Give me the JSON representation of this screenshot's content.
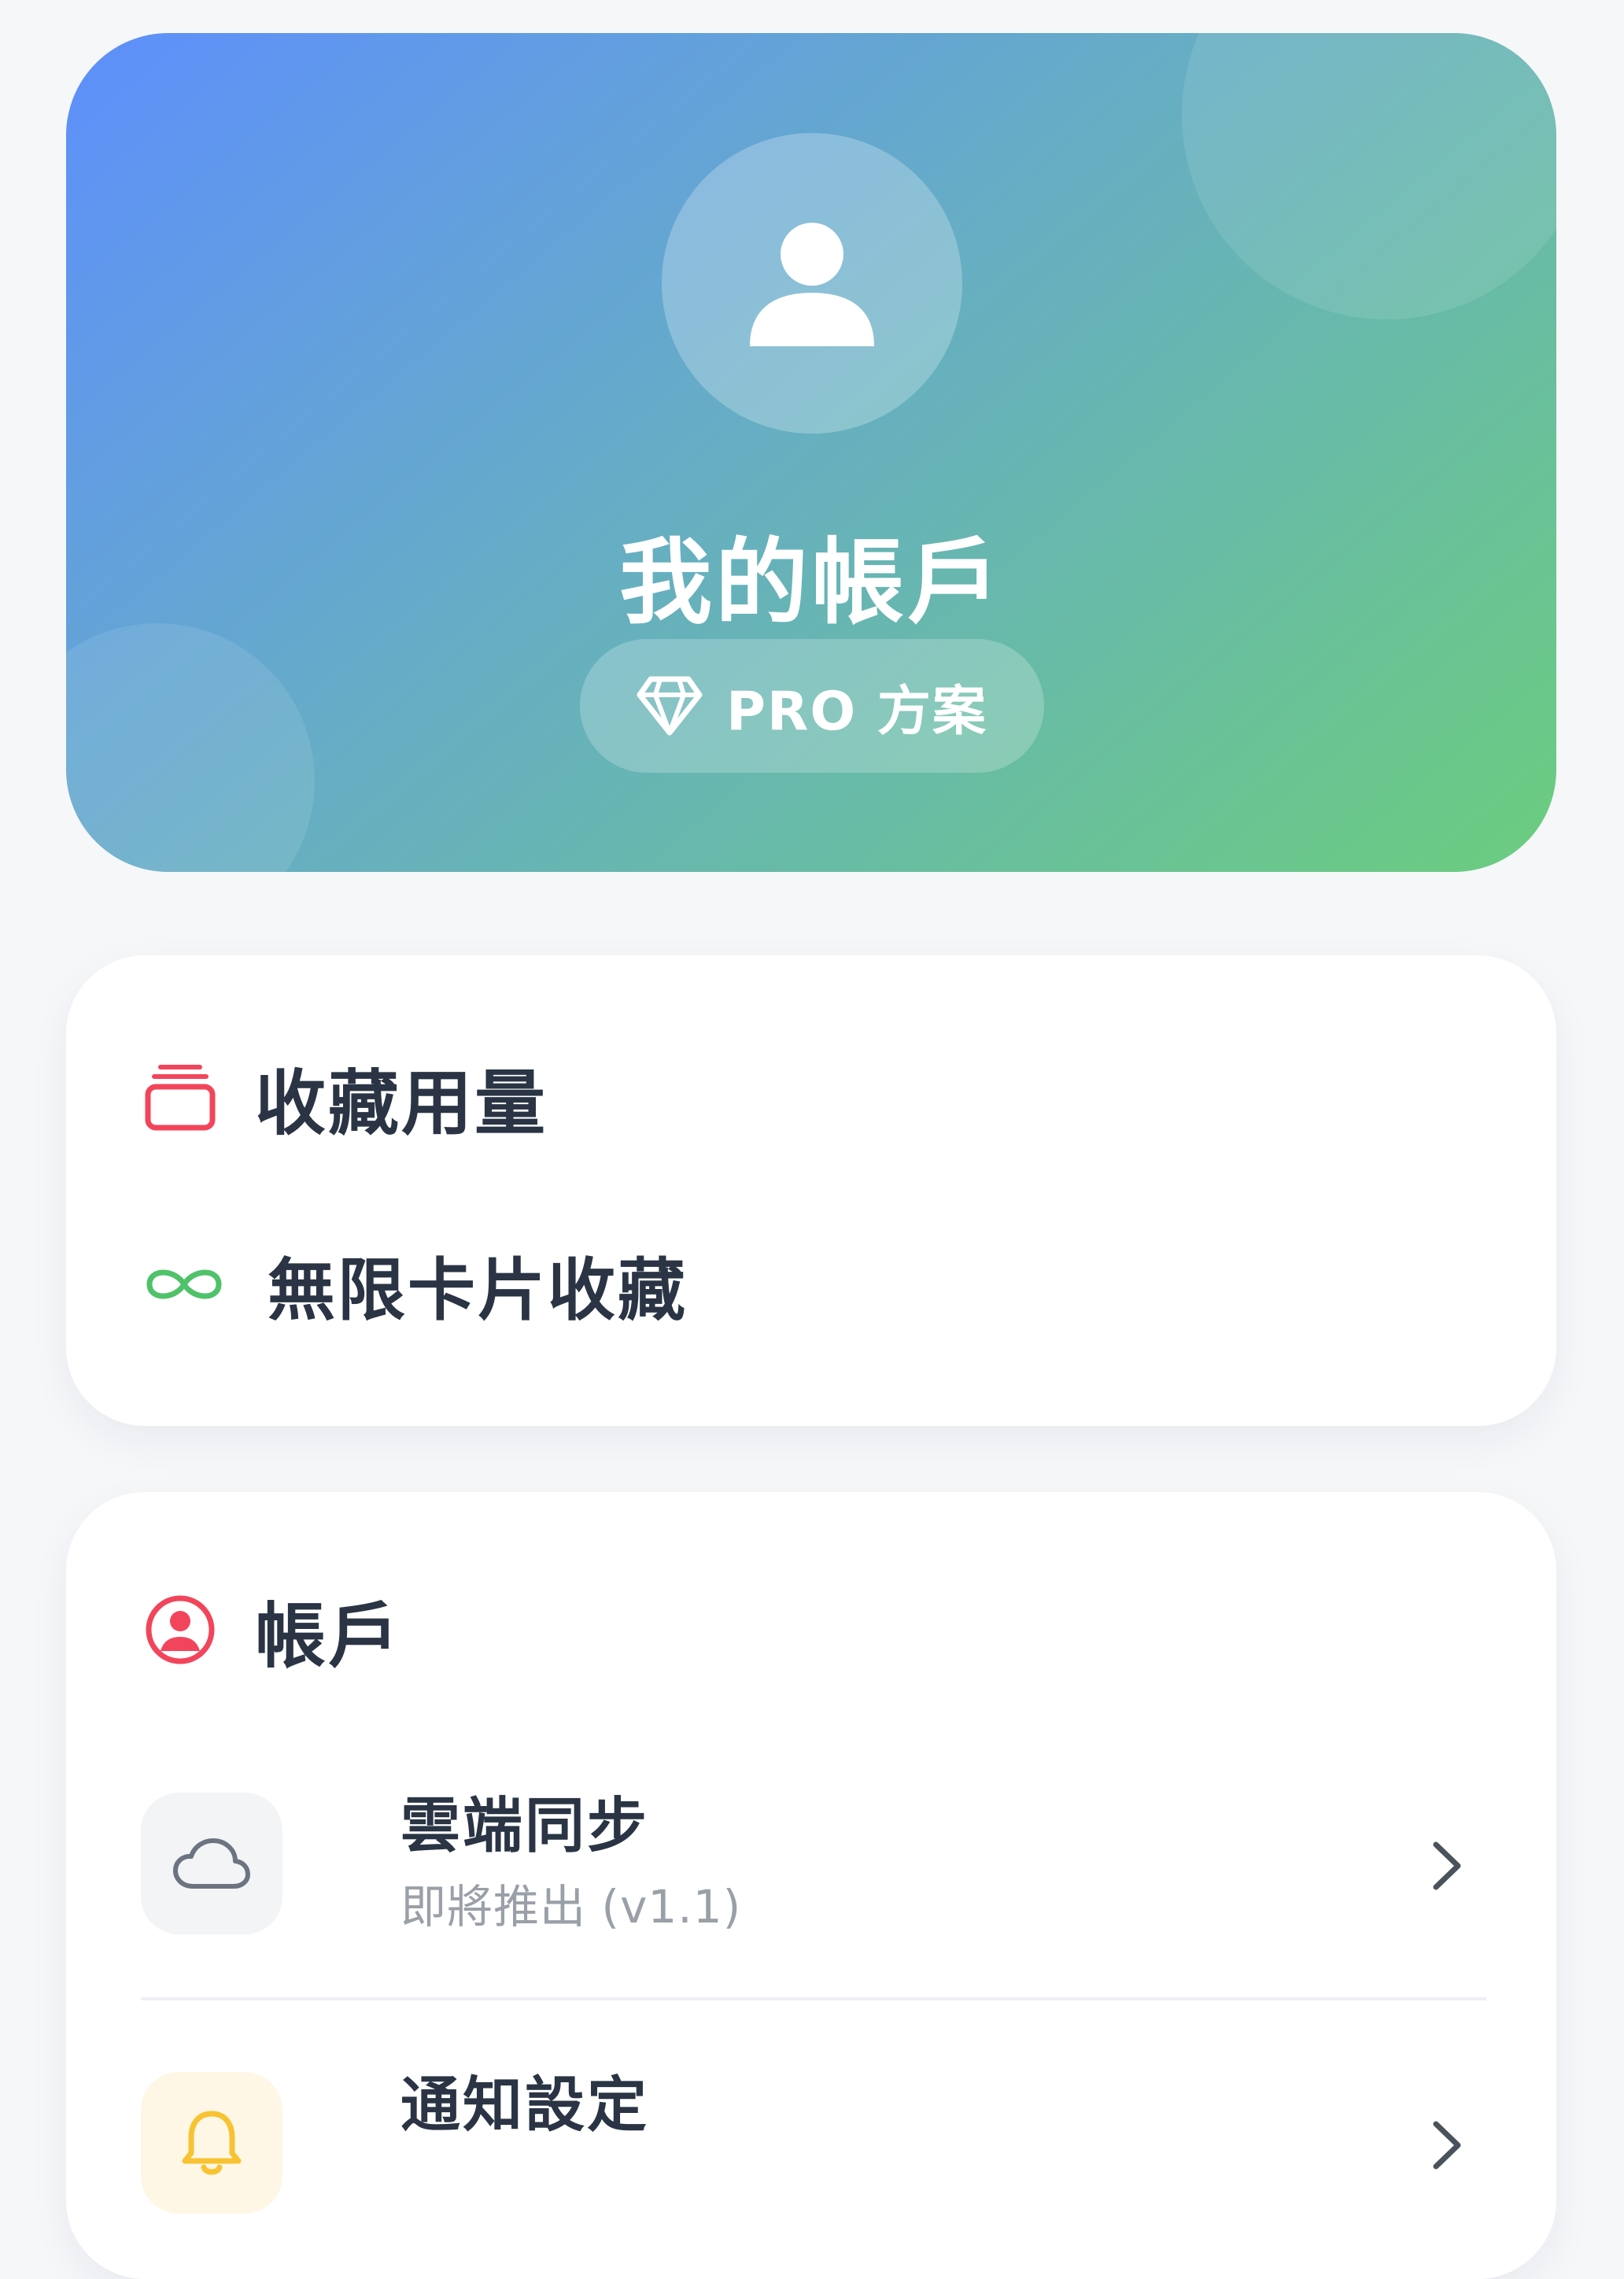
{
  "profile": {
    "title": "我的帳戶",
    "plan_label": "PRO 方案"
  },
  "usage": {
    "title": "收藏用量",
    "unlimited_label": "無限卡片收藏"
  },
  "account": {
    "title": "帳戶",
    "items": [
      {
        "title": "雲端同步",
        "subtitle": "即將推出 (v1.1)",
        "icon": "cloud-icon"
      },
      {
        "title": "通知設定",
        "subtitle": "",
        "icon": "bell-icon"
      }
    ]
  },
  "colors": {
    "gradient_start": "#5e8ffc",
    "gradient_end": "#6bcd7e",
    "accent_red": "#f2455b",
    "accent_green": "#4fc26a",
    "bell_yellow": "#f7c331",
    "text_dark": "#2a3444",
    "text_muted": "#9aa0a8"
  }
}
